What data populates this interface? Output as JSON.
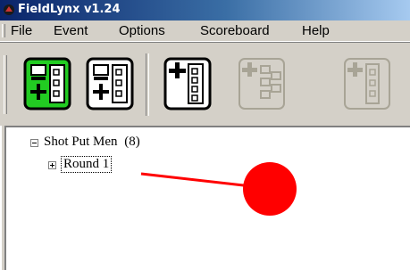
{
  "window": {
    "title": "FieldLynx  v1.24"
  },
  "menu": {
    "items": [
      "File",
      "Event",
      "Options",
      "Scoreboard",
      "Help"
    ]
  },
  "toolbar": {
    "buttons": [
      {
        "icon": "event-list-icon",
        "enabled": true,
        "active": true
      },
      {
        "icon": "event-list-icon",
        "enabled": true,
        "active": false
      },
      {
        "icon": "add-event-icon",
        "enabled": true,
        "active": false
      },
      {
        "icon": "add-round-icon",
        "enabled": false,
        "active": false
      },
      {
        "icon": "add-flight-icon",
        "enabled": false,
        "active": false
      }
    ],
    "colors": {
      "active_bg": "#22cc22",
      "disabled": "#a8a496"
    }
  },
  "tree": {
    "event": {
      "label": "Shot Put Men",
      "count": "(8)",
      "expanded": true
    },
    "round": {
      "label": "Round 1",
      "expanded": false,
      "selected": true
    }
  },
  "annotation": {
    "color": "#ff0000",
    "shape": "arrow-with-circle"
  }
}
